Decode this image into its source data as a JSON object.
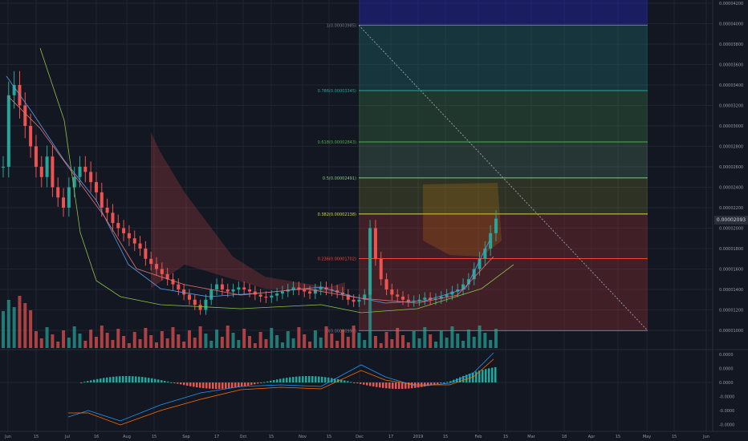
{
  "theme": {
    "background": "#131722",
    "grid": "#1f2433",
    "text": "#9598a1",
    "bull": "#26a69a",
    "bear": "#ef5350",
    "fib_diagonal": "#9598a1"
  },
  "price_axis": {
    "labels": [
      "0.00004200",
      "0.00004000",
      "0.00003800",
      "0.00003600",
      "0.00003400",
      "0.00003200",
      "0.00003000",
      "0.00002800",
      "0.00002600",
      "0.00002400",
      "0.00002200",
      "0.00002000",
      "0.00001800",
      "0.00001600",
      "0.00001400",
      "0.00001200",
      "0.00001000"
    ],
    "current_price": "0.00002093"
  },
  "macd_axis": {
    "labels": [
      "0.0000",
      "0.0000",
      "0.0000",
      "-0.0000",
      "-0.0000",
      "-0.0000"
    ]
  },
  "time_axis": {
    "labels": [
      "Jun",
      "15",
      "Jul",
      "16",
      "Aug",
      "15",
      "Sep",
      "17",
      "Oct",
      "15",
      "Nov",
      "15",
      "Dec",
      "17",
      "2019",
      "15",
      "Feb",
      "15",
      "Mar",
      "18",
      "Apr",
      "15",
      "May",
      "15",
      "Jun"
    ]
  },
  "fib_levels": [
    {
      "ratio": "1",
      "price": "0.00003985",
      "label": "1(0.00003985)",
      "color": "#787b86",
      "fill": "rgba(120,123,134,0.25)"
    },
    {
      "ratio": "0.786",
      "price": "0.00003345",
      "label": "0.786(0.00003345)",
      "color": "#26a69a",
      "fill": "rgba(38,166,154,0.22)"
    },
    {
      "ratio": "0.618",
      "price": "0.00002843",
      "label": "0.618(0.00002843)",
      "color": "#4caf50",
      "fill": "rgba(76,175,80,0.22)"
    },
    {
      "ratio": "0.5",
      "price": "0.00002491",
      "label": "0.5(0.00002491)",
      "color": "#81c784",
      "fill": "rgba(129,199,132,0.18)"
    },
    {
      "ratio": "0.382",
      "price": "0.00002138",
      "label": "0.382(0.00002138)",
      "color": "#cddc39",
      "fill": "rgba(205,220,57,0.14)"
    },
    {
      "ratio": "0.236",
      "price": "0.00001702",
      "label": "0.236(0.00001702)",
      "color": "#f44336",
      "fill": "rgba(244,67,54,0.2)"
    },
    {
      "ratio": "0",
      "price": "0.00000997",
      "label": "0(0.00000997)",
      "color": "#787b86",
      "fill": "rgba(244,67,54,0.2)"
    }
  ],
  "fib_extension": {
    "fill": "rgba(33,37,150,0.55)"
  },
  "chart_data": {
    "type": "candlestick",
    "symbol_interval": "1D",
    "x_range": [
      "2018-05-31",
      "2019-06-08"
    ],
    "y_range": [
      9e-06,
      4.25e-05
    ],
    "close": [
      2.6e-05,
      3.3e-05,
      3.4e-05,
      3.2e-05,
      3e-05,
      2.8e-05,
      2.6e-05,
      2.5e-05,
      2.7e-05,
      2.4e-05,
      2.3e-05,
      2.2e-05,
      2.4e-05,
      2.5e-05,
      2.6e-05,
      2.55e-05,
      2.45e-05,
      2.35e-05,
      2.2e-05,
      2.15e-05,
      2.05e-05,
      2e-05,
      1.95e-05,
      1.9e-05,
      1.85e-05,
      1.8e-05,
      1.7e-05,
      1.65e-05,
      1.6e-05,
      1.55e-05,
      1.5e-05,
      1.45e-05,
      1.4e-05,
      1.35e-05,
      1.3e-05,
      1.25e-05,
      1.2e-05,
      1.3e-05,
      1.4e-05,
      1.45e-05,
      1.4e-05,
      1.38e-05,
      1.4e-05,
      1.42e-05,
      1.4e-05,
      1.38e-05,
      1.35e-05,
      1.33e-05,
      1.32e-05,
      1.34e-05,
      1.36e-05,
      1.38e-05,
      1.4e-05,
      1.42e-05,
      1.4e-05,
      1.38e-05,
      1.36e-05,
      1.4e-05,
      1.42e-05,
      1.4e-05,
      1.39e-05,
      1.37e-05,
      1.35e-05,
      1.3e-05,
      1.28e-05,
      1.3e-05,
      1.35e-05,
      2e-05,
      1.7e-05,
      1.5e-05,
      1.4e-05,
      1.35e-05,
      1.33e-05,
      1.3e-05,
      1.28e-05,
      1.29e-05,
      1.3e-05,
      1.32e-05,
      1.3e-05,
      1.31e-05,
      1.33e-05,
      1.35e-05,
      1.38e-05,
      1.4e-05,
      1.45e-05,
      1.5e-05,
      1.6e-05,
      1.7e-05,
      1.8e-05,
      1.95e-05,
      2.093e-05
    ]
  }
}
